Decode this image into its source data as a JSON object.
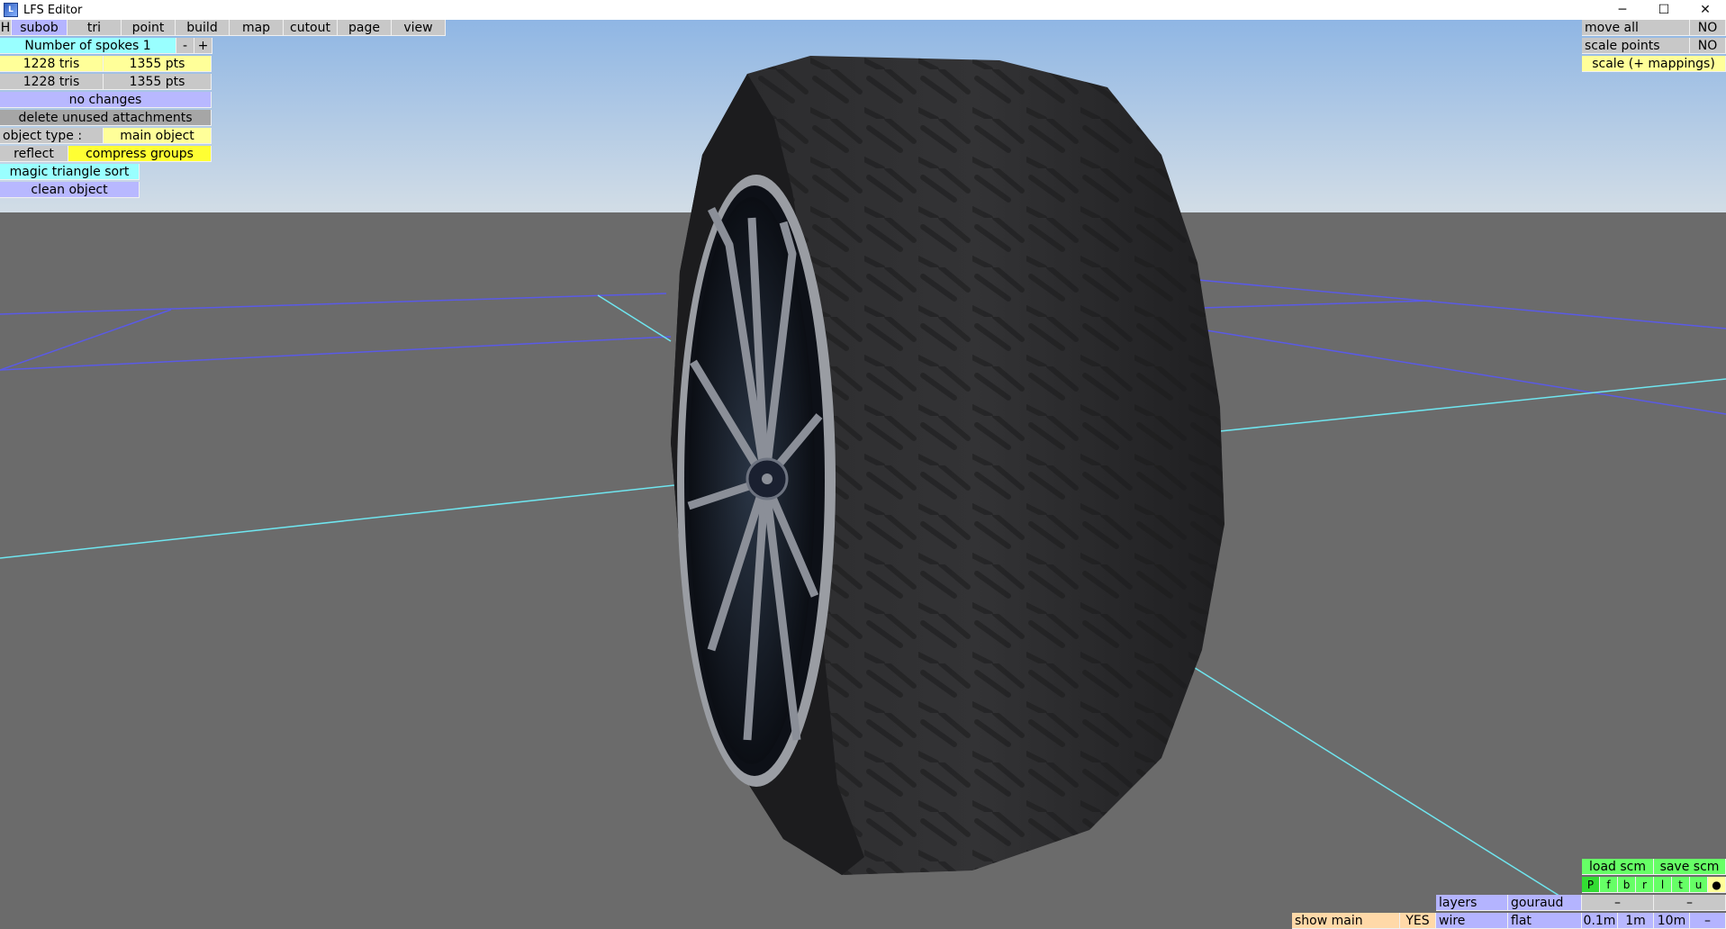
{
  "window": {
    "title": "LFS Editor",
    "minimize": "─",
    "maximize": "☐",
    "close": "✕"
  },
  "menu": {
    "h": "H",
    "tabs": [
      "subob",
      "tri",
      "point",
      "build",
      "map",
      "cutout",
      "page",
      "view"
    ]
  },
  "left_panel": {
    "spokes_label": "Number of spokes 1",
    "minus": "-",
    "plus": "+",
    "row1_tris": "1228 tris",
    "row1_pts": "1355 pts",
    "row2_tris": "1228 tris",
    "row2_pts": "1355 pts",
    "status": "no changes",
    "delete_unused": "delete unused attachments",
    "object_type_label": "object type :",
    "object_type_value": "main object",
    "reflect": "reflect",
    "compress_groups": "compress groups",
    "magic_triangle_sort": "magic triangle sort",
    "clean_object": "clean object"
  },
  "right_panel": {
    "move_all": "move all",
    "move_all_value": "NO",
    "scale_points": "scale points",
    "scale_points_value": "NO",
    "scale_mappings": "scale (+ mappings)"
  },
  "bottom_panel": {
    "load_scm": "load scm",
    "save_scm": "save scm",
    "flags": [
      "P",
      "f",
      "b",
      "r",
      "l",
      "t",
      "u",
      "●"
    ],
    "dash1": "–",
    "dash2": "–",
    "layers": "layers",
    "gouraud": "gouraud",
    "show_main": "show main",
    "show_main_value": "YES",
    "wire": "wire",
    "flat": "flat",
    "grid_01": "0.1m",
    "grid_1": "1m",
    "grid_10": "10m",
    "grid_dash": "–"
  }
}
